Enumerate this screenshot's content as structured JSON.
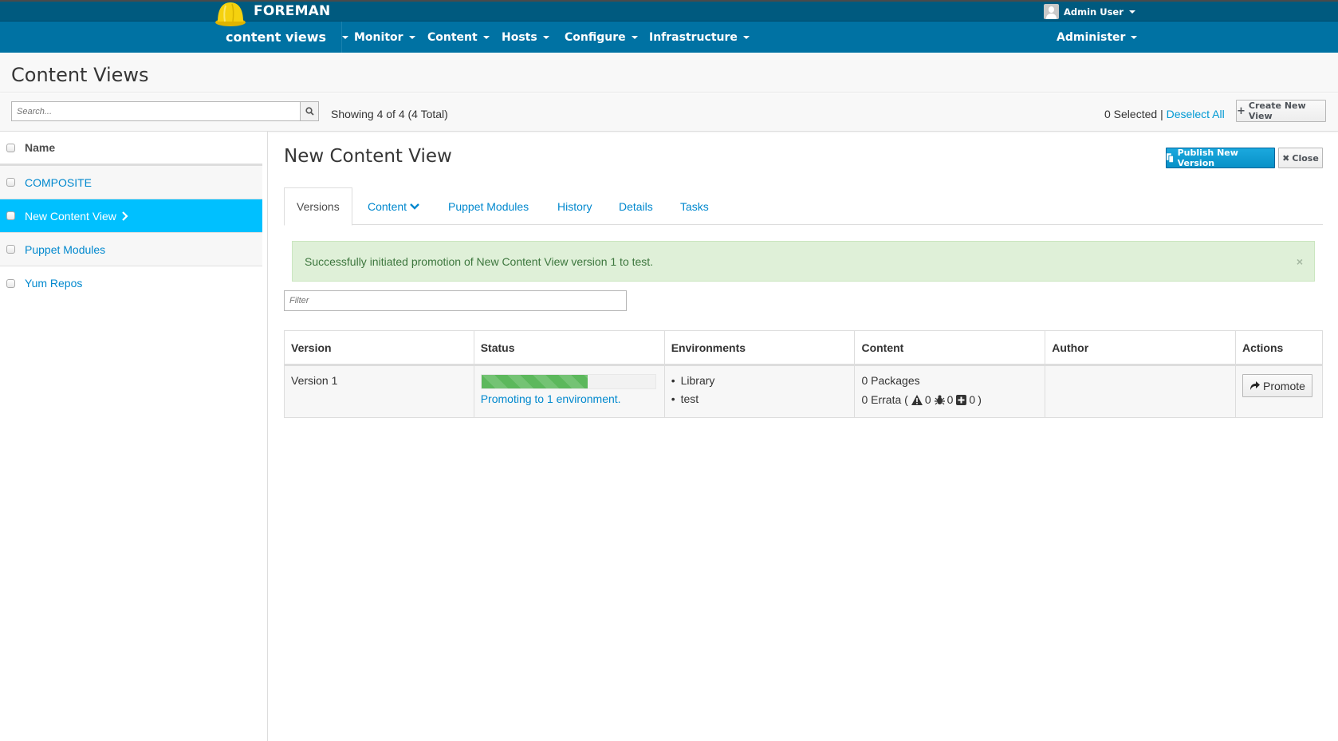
{
  "app": {
    "brand": "FOREMAN",
    "user_menu": "Admin User",
    "context_menu": "content views",
    "nav": [
      "Monitor",
      "Content",
      "Hosts",
      "Configure",
      "Infrastructure"
    ],
    "admin_menu": "Administer",
    "brand_color": "#0072a3"
  },
  "page": {
    "title": "Content Views",
    "search_placeholder": "Search...",
    "showing": "Showing 4 of 4 (4 Total)",
    "selected": "0 Selected",
    "separator": "|",
    "deselect_all": "Deselect All",
    "create_button": "Create New View"
  },
  "sidebar": {
    "header": "Name",
    "items": [
      {
        "label": "COMPOSITE",
        "active": false
      },
      {
        "label": "New Content View",
        "active": true
      },
      {
        "label": "Puppet Modules",
        "active": false
      },
      {
        "label": "Yum Repos",
        "active": false
      }
    ]
  },
  "detail": {
    "title": "New Content View",
    "publish_button": "Publish New Version",
    "close_button": "Close",
    "tabs": [
      "Versions",
      "Content",
      "Puppet Modules",
      "History",
      "Details",
      "Tasks"
    ],
    "active_tab": "Versions",
    "alert": "Successfully initiated promotion of New Content View version 1 to test.",
    "alert_close": "×",
    "filter_placeholder": "Filter",
    "table": {
      "headers": [
        "Version",
        "Status",
        "Environments",
        "Content",
        "Author",
        "Actions"
      ],
      "rows": [
        {
          "version": "Version 1",
          "progress_percent": 61,
          "status_text": "Promoting to 1 environment.",
          "environments": [
            "Library",
            "test"
          ],
          "packages": "0 Packages",
          "errata_label": "0 Errata (",
          "errata_security": "0",
          "errata_bugfix": "0",
          "errata_enhancement": "0",
          "errata_close": ")",
          "author": "",
          "action": "Promote"
        }
      ]
    }
  }
}
